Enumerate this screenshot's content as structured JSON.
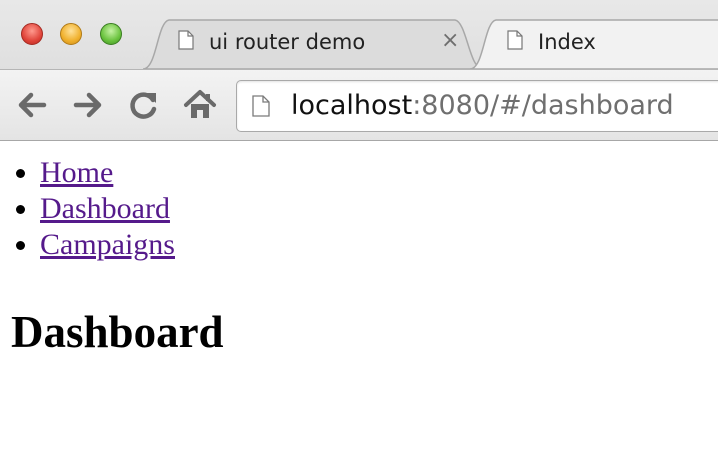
{
  "browser": {
    "tabs": [
      {
        "title": "ui router demo",
        "close_glyph": "×"
      },
      {
        "title": "Index"
      }
    ],
    "address_bar": {
      "url_host": "localhost",
      "url_rest": ":8080/#/dashboard"
    }
  },
  "page": {
    "nav_links": [
      "Home",
      "Dashboard",
      "Campaigns"
    ],
    "heading": "Dashboard"
  }
}
